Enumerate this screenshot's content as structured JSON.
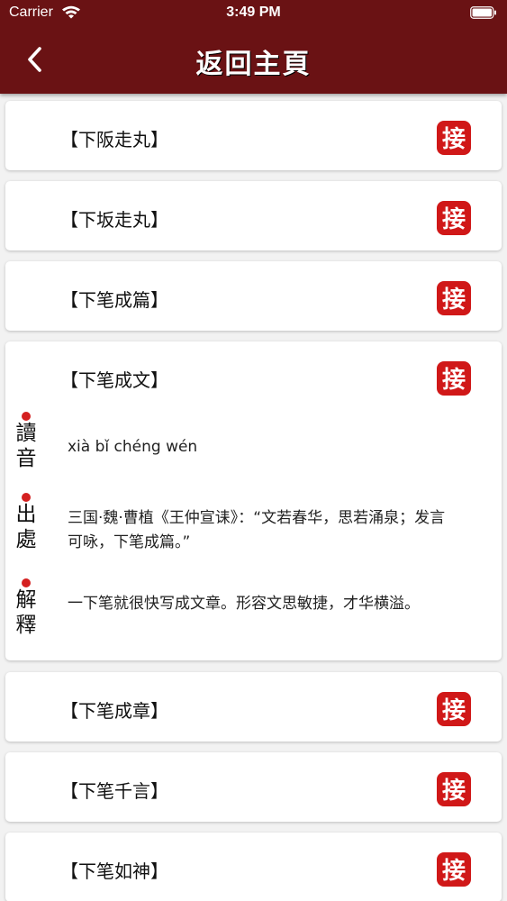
{
  "status_bar": {
    "carrier": "Carrier",
    "time": "3:49 PM"
  },
  "nav": {
    "title": "返回主頁"
  },
  "list": {
    "items": [
      {
        "title": "【下阪走丸】"
      },
      {
        "title": "【下坂走丸】"
      },
      {
        "title": "【下笔成篇】"
      },
      {
        "title": "【下笔成文】",
        "pinyin": "xià bǐ chéng wén",
        "source": "三国·魏·曹植《王仲宣诔》：“文若春华，思若涌泉；发言可咏，下笔成篇。”",
        "meaning": "一下笔就很快写成文章。形容文思敏捷，才华横溢。"
      },
      {
        "title": "【下笔成章】"
      },
      {
        "title": "【下笔千言】"
      },
      {
        "title": "【下笔如神】"
      }
    ]
  },
  "side_labels": {
    "pronunciation": [
      "讀",
      "音"
    ],
    "origin": [
      "出",
      "處"
    ],
    "explanation": [
      "解",
      "釋"
    ]
  },
  "seal": {
    "char": "接",
    "color": "#d01818",
    "icon": "seal-stamp-icon"
  },
  "colors": {
    "header": "#6a1214",
    "accent": "#d42020"
  }
}
